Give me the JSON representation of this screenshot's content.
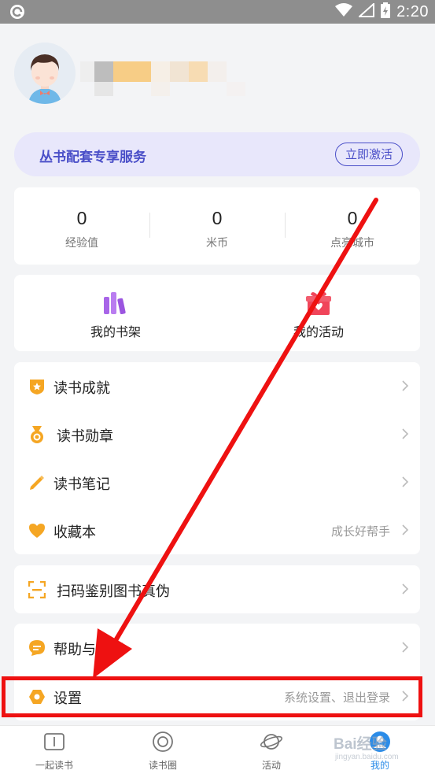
{
  "status_bar": {
    "time": "2:20",
    "icons": [
      "app-notification-icon",
      "wifi-icon",
      "cellular-signal-icon",
      "battery-charging-icon"
    ]
  },
  "profile": {
    "avatar_icon": "boy-avatar-icon",
    "username_redacted": true
  },
  "vip_banner": {
    "title": "丛书配套专享服务",
    "button": "立即激活",
    "accent": "#4a4fc8",
    "background": "#e8e7fb"
  },
  "stats": [
    {
      "value": "0",
      "label": "经验值"
    },
    {
      "value": "0",
      "label": "米币"
    },
    {
      "value": "0",
      "label": "点亮城市"
    }
  ],
  "shortcuts": [
    {
      "label": "我的书架",
      "icon": "bookshelf-icon"
    },
    {
      "label": "我的活动",
      "icon": "gift-icon"
    }
  ],
  "menu_group_1": [
    {
      "label": "读书成就",
      "icon": "achievement-shield-icon",
      "sub": ""
    },
    {
      "label": "读书勋章",
      "icon": "medal-icon",
      "sub": ""
    },
    {
      "label": "读书笔记",
      "icon": "pencil-icon",
      "sub": ""
    },
    {
      "label": "收藏本",
      "icon": "heart-icon",
      "sub": "成长好帮手"
    }
  ],
  "menu_group_2": [
    {
      "label": "扫码鉴别图书真伪",
      "icon": "scan-icon",
      "sub": ""
    }
  ],
  "menu_group_3": [
    {
      "label": "帮助与反馈",
      "icon": "chat-bubble-icon",
      "sub": ""
    },
    {
      "label": "设置",
      "icon": "settings-hexagon-icon",
      "sub": "系统设置、退出登录"
    }
  ],
  "bottom_nav": [
    {
      "label": "一起读书",
      "icon": "book-icon",
      "active": false
    },
    {
      "label": "读书圈",
      "icon": "circle-icon",
      "active": false
    },
    {
      "label": "活动",
      "icon": "planet-icon",
      "active": false
    },
    {
      "label": "我的",
      "icon": "profile-icon",
      "active": true
    }
  ],
  "annotation": {
    "color": "#ee1111"
  },
  "watermark": {
    "text": "Bai经验",
    "sub": "jingyan.baidu.com"
  },
  "colors": {
    "icon_orange": "#f5a623",
    "bookshelf_purple": "#a865e8",
    "gift_red": "#f0455a",
    "nav_active": "#2b8ce8"
  }
}
